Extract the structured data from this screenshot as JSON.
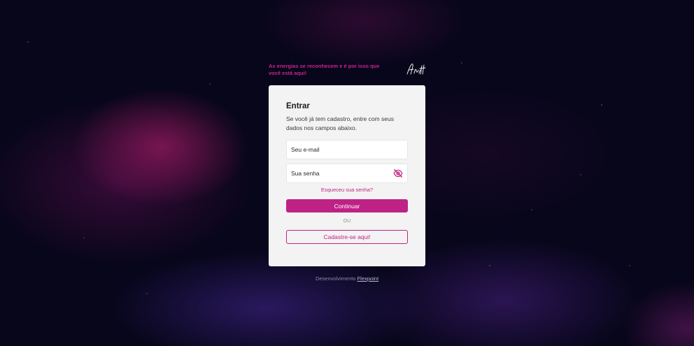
{
  "header": {
    "tagline": "As energias se reconhecem e é por isso que você está aqui!",
    "logo_text": "Aretta"
  },
  "login": {
    "title": "Entrar",
    "description": "Se você já tem cadastro, entre com seus dados nos campos abaixo.",
    "email_placeholder": "Seu e-mail",
    "password_placeholder": "Sua senha",
    "forgot_link": "Esqueceu sua senha?",
    "submit_label": "Continuar",
    "divider": "OU",
    "register_label": "Cadastre-se aqui!"
  },
  "footer": {
    "prefix": "Desenvolvimento",
    "link": "Flexpoint"
  },
  "colors": {
    "accent": "#bf2285",
    "card_bg": "#f3f3f3",
    "page_bg": "#07061a"
  },
  "icons": {
    "password_toggle": "eye-off-icon"
  }
}
